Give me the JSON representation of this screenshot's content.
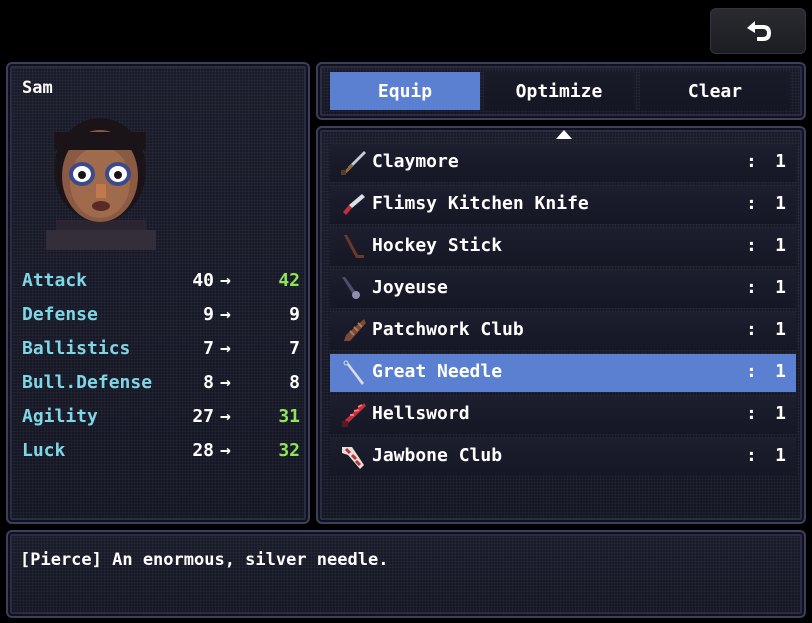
{
  "back_button": {
    "icon": "undo-arrow-icon"
  },
  "character": {
    "name": "Sam",
    "portrait": "character-portrait",
    "stats": [
      {
        "label": "Attack",
        "current": "40",
        "arrow": "→",
        "new": "42",
        "new_color": "#8ee35a"
      },
      {
        "label": "Defense",
        "current": "9",
        "arrow": "→",
        "new": "9",
        "new_color": "#ffffff"
      },
      {
        "label": "Ballistics",
        "current": "7",
        "arrow": "→",
        "new": "7",
        "new_color": "#ffffff"
      },
      {
        "label": "Bull.Defense",
        "current": "8",
        "arrow": "→",
        "new": "8",
        "new_color": "#ffffff"
      },
      {
        "label": "Agility",
        "current": "27",
        "arrow": "→",
        "new": "31",
        "new_color": "#8ee35a"
      },
      {
        "label": "Luck",
        "current": "28",
        "arrow": "→",
        "new": "32",
        "new_color": "#8ee35a"
      }
    ]
  },
  "tabs": [
    {
      "label": "Equip",
      "active": true
    },
    {
      "label": "Optimize",
      "active": false
    },
    {
      "label": "Clear",
      "active": false
    }
  ],
  "items": [
    {
      "name": "Claymore",
      "colon": ":",
      "qty": "1",
      "icon": "sword-icon",
      "selected": false
    },
    {
      "name": "Flimsy Kitchen Knife",
      "colon": ":",
      "qty": "1",
      "icon": "knife-icon",
      "selected": false
    },
    {
      "name": "Hockey Stick",
      "colon": ":",
      "qty": "1",
      "icon": "hockey-stick-icon",
      "selected": false
    },
    {
      "name": "Joyeuse",
      "colon": ":",
      "qty": "1",
      "icon": "dark-sword-icon",
      "selected": false
    },
    {
      "name": "Patchwork Club",
      "colon": ":",
      "qty": "1",
      "icon": "club-icon",
      "selected": false
    },
    {
      "name": "Great Needle",
      "colon": ":",
      "qty": "1",
      "icon": "needle-icon",
      "selected": true
    },
    {
      "name": "Hellsword",
      "colon": ":",
      "qty": "1",
      "icon": "red-sword-icon",
      "selected": false
    },
    {
      "name": "Jawbone Club",
      "colon": ":",
      "qty": "1",
      "icon": "bone-club-icon",
      "selected": false
    }
  ],
  "description": "[Pierce] An enormous, silver needle.",
  "colors": {
    "accent": "#5b7fd1",
    "stat_label": "#7fd6e6",
    "stat_increase": "#8ee35a"
  }
}
